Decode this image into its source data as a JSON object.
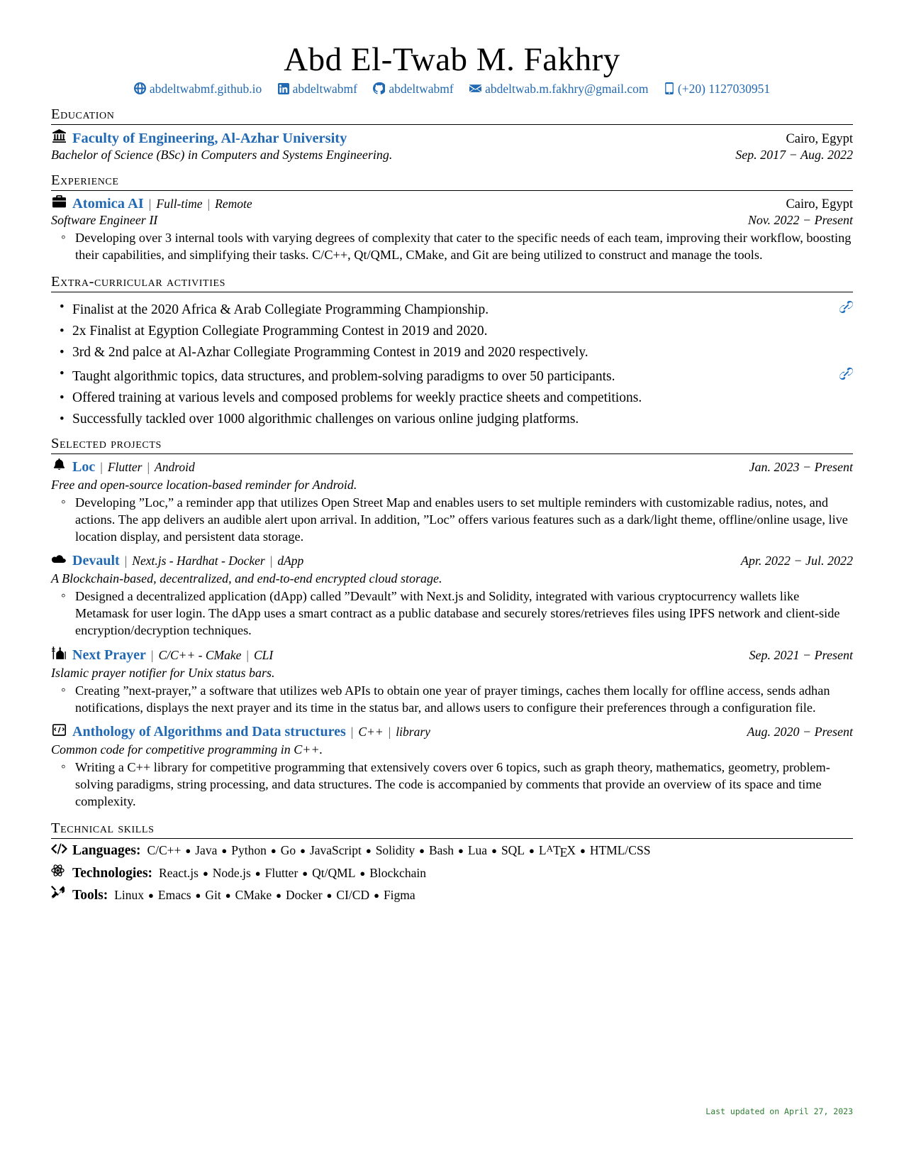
{
  "header": {
    "name": "Abd El-Twab M. Fakhry",
    "contacts": [
      {
        "icon": "globe-icon",
        "text": "abdeltwabmf.github.io"
      },
      {
        "icon": "linkedin-icon",
        "text": "abdeltwabmf"
      },
      {
        "icon": "github-icon",
        "text": "abdeltwabmf"
      },
      {
        "icon": "envelope-icon",
        "text": "abdeltwab.m.fakhry@gmail.com"
      },
      {
        "icon": "phone-icon",
        "text": "(+20) 1127030951"
      }
    ],
    "accent_color": "#2269b3"
  },
  "education": {
    "heading": "Education",
    "entries": [
      {
        "icon": "university-icon",
        "org": "Faculty of Engineering, Al-Azhar University",
        "location": "Cairo, Egypt",
        "degree": "Bachelor of Science (BSc) in Computers and Systems Engineering.",
        "dates": "Sep. 2017 − Aug. 2022"
      }
    ]
  },
  "experience": {
    "heading": "Experience",
    "entries": [
      {
        "icon": "briefcase-icon",
        "org": "Atomica AI",
        "tags": [
          "Full-time",
          "Remote"
        ],
        "location": "Cairo, Egypt",
        "role": "Software Engineer II",
        "dates": "Nov. 2022 − Present",
        "bullets": [
          "Developing over 3 internal tools with varying degrees of complexity that cater to the specific needs of each team, improving their workflow, boosting their capabilities, and simplifying their tasks. C/C++, Qt/QML, CMake, and Git are being utilized to construct and manage the tools."
        ]
      }
    ]
  },
  "extracurricular": {
    "heading": "Extra-curricular Activities",
    "items": [
      {
        "text": "Finalist at the 2020 Africa & Arab Collegiate Programming Championship.",
        "link": true
      },
      {
        "text": "2x Finalist at Egyption Collegiate Programming Contest in 2019 and 2020.",
        "link": false
      },
      {
        "text": "3rd & 2nd palce at Al-Azhar Collegiate Programming Contest in 2019 and 2020 respectively.",
        "link": false
      },
      {
        "text": "Taught algorithmic topics, data structures, and problem-solving paradigms to over 50 participants.",
        "link": true
      },
      {
        "text": "Offered training at various levels and composed problems for weekly practice sheets and competitions.",
        "link": false
      },
      {
        "text": "Successfully tackled over 1000 algorithmic challenges on various online judging platforms.",
        "link": false
      }
    ]
  },
  "projects": {
    "heading": "Selected Projects",
    "entries": [
      {
        "icon": "bell-icon",
        "name": "Loc",
        "tags": [
          "Flutter",
          "Android"
        ],
        "dates": "Jan. 2023 − Present",
        "summary": "Free and open-source location-based reminder for Android.",
        "bullets": [
          "Developing ”Loc,” a reminder app that utilizes Open Street Map and enables users to set multiple reminders with customizable radius, notes, and actions. The app delivers an audible alert upon arrival. In addition, ”Loc” offers various features such as a dark/light theme, offline/online usage, live location display, and persistent data storage."
        ]
      },
      {
        "icon": "cloud-icon",
        "name": "Devault",
        "tags": [
          "Next.js - Hardhat - Docker",
          "dApp"
        ],
        "dates": "Apr. 2022 − Jul. 2022",
        "summary": "A Blockchain-based, decentralized, and end-to-end encrypted cloud storage.",
        "bullets": [
          "Designed a decentralized application (dApp) called ”Devault” with Next.js and Solidity, integrated with various cryptocurrency wallets like Metamask for user login. The dApp uses a smart contract as a public database and securely stores/retrieves files using IPFS network and client-side encryption/decryption techniques."
        ]
      },
      {
        "icon": "mosque-icon",
        "name": "Next Prayer",
        "tags": [
          "C/C++ - CMake",
          "CLI"
        ],
        "dates": "Sep. 2021 − Present",
        "summary": "Islamic prayer notifier for Unix status bars.",
        "bullets": [
          "Creating ”next-prayer,” a software that utilizes web APIs to obtain one year of prayer timings, caches them locally for offline access, sends adhan notifications, displays the next prayer and its time in the status bar, and allows users to configure their preferences through a configuration file."
        ]
      },
      {
        "icon": "book-icon",
        "name": "Anthology of Algorithms and Data structures",
        "tags": [
          "C++",
          "library"
        ],
        "dates": "Aug. 2020 − Present",
        "summary": "Common code for competitive programming in C++.",
        "bullets": [
          "Writing a C++ library for competitive programming that extensively covers over 6 topics, such as graph theory, mathematics, geometry, problem-solving paradigms, string processing, and data structures. The code is accompanied by comments that provide an overview of its space and time complexity."
        ]
      }
    ]
  },
  "skills": {
    "heading": "Technical Skills",
    "rows": [
      {
        "icon": "code-icon",
        "label": "Languages:",
        "values": [
          "C/C++",
          "Java",
          "Python",
          "Go",
          "JavaScript",
          "Solidity",
          "Bash",
          "Lua",
          "SQL",
          "LaTeX",
          "HTML/CSS"
        ]
      },
      {
        "icon": "atom-icon",
        "label": "Technologies:",
        "values": [
          "React.js",
          "Node.js",
          "Flutter",
          "Qt/QML",
          "Blockchain"
        ]
      },
      {
        "icon": "tools-icon",
        "label": "Tools:",
        "values": [
          "Linux",
          "Emacs",
          "Git",
          "CMake",
          "Docker",
          "CI/CD",
          "Figma"
        ]
      }
    ]
  },
  "footer": {
    "updated": "Last updated on April 27, 2023",
    "updated_color": "#2e7d32"
  }
}
